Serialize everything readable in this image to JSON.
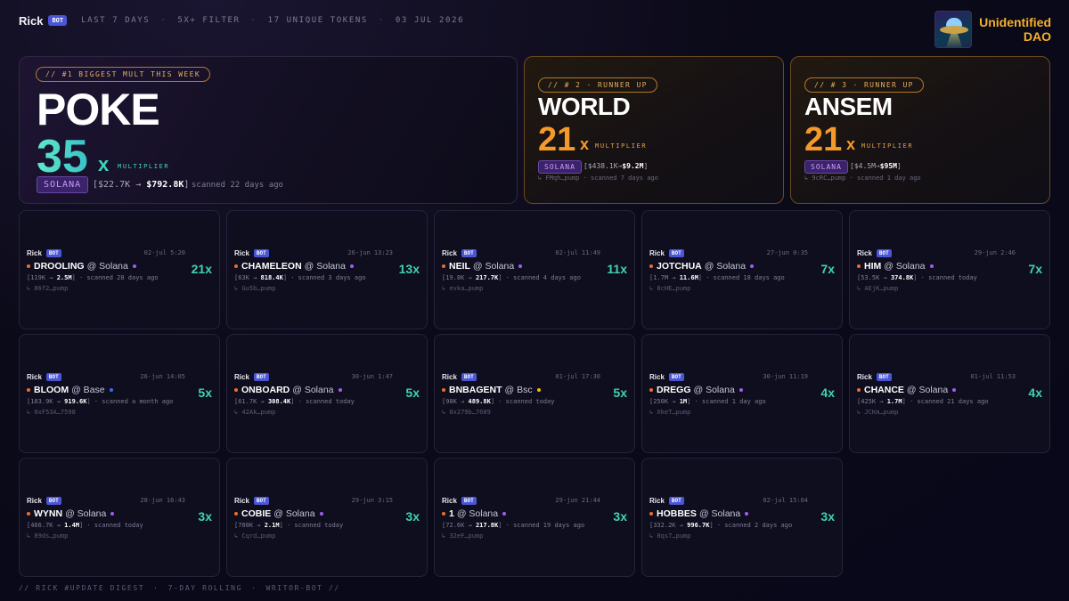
{
  "header": {
    "brand": "Rick",
    "bot_badge": "BOT",
    "meta": [
      "LAST 7 DAYS",
      "5X+ FILTER",
      "17 UNIQUE TOKENS",
      "03 JUL 2026"
    ],
    "separator": "·"
  },
  "dao": {
    "line1": "Unidentified",
    "line2": "DAO",
    "logo_icon": "ufo-icon"
  },
  "hero": [
    {
      "pill": "//  #1 BIGGEST MULT THIS WEEK",
      "token": "POKE",
      "mult": "35",
      "x": "x",
      "mult_label": "MULTIPLIER",
      "chain": "SOLANA",
      "range_pre": "[$22.7K → ",
      "range_to": "$792.8K",
      "range_post": "]",
      "scanned": "scanned 22 days ago"
    },
    {
      "pill": "// # 2 · RUNNER UP",
      "token": "WORLD",
      "mult": "21",
      "x": "x",
      "mult_label": "MULTIPLIER",
      "chain": "SOLANA",
      "range_pre": "[$438.1K→",
      "range_to": "$9.2M",
      "range_post": "]",
      "addr": "↳ FMqh…pump · scanned 7 days ago"
    },
    {
      "pill": "// # 3 · RUNNER UP",
      "token": "ANSEM",
      "mult": "21",
      "x": "x",
      "mult_label": "MULTIPLIER",
      "chain": "SOLANA",
      "range_pre": "[$4.5M→",
      "range_to": "$95M",
      "range_post": "]",
      "addr": "↳ 9cRC…pump · scanned 1 day ago"
    }
  ],
  "cards": [
    {
      "rick": "Rick",
      "bot": "BOT",
      "date": "02-jul 5:20",
      "token": "DROOLING",
      "at": "@ Solana",
      "chain_color": "#a45cf0",
      "mult": "21x",
      "range_pre": "[119K → ",
      "range_to": "2.5M",
      "range_post": "] · scanned 28 days ago",
      "addr": "↳ 86f2…pump"
    },
    {
      "rick": "Rick",
      "bot": "BOT",
      "date": "26-jun 13:23",
      "token": "CHAMELEON",
      "at": "@ Solana",
      "chain_color": "#a45cf0",
      "mult": "13x",
      "range_pre": "[63K → ",
      "range_to": "818.4K",
      "range_post": "] · scanned 3 days ago",
      "addr": "↳ Gu5b…pump"
    },
    {
      "rick": "Rick",
      "bot": "BOT",
      "date": "02-jul 11:49",
      "token": "NEIL",
      "at": "@ Solana",
      "chain_color": "#a45cf0",
      "mult": "11x",
      "range_pre": "[19.8K → ",
      "range_to": "217.7K",
      "range_post": "] · scanned 4 days ago",
      "addr": "↳ evka…pump"
    },
    {
      "rick": "Rick",
      "bot": "BOT",
      "date": "27-jun 0:35",
      "token": "JOTCHUA",
      "at": "@ Solana",
      "chain_color": "#a45cf0",
      "mult": "7x",
      "range_pre": "[1.7M → ",
      "range_to": "11.6M",
      "range_post": "] · scanned 18 days ago",
      "addr": "↳ 8cHE…pump"
    },
    {
      "rick": "Rick",
      "bot": "BOT",
      "date": "29-jun 2:46",
      "token": "HIM",
      "at": "@ Solana",
      "chain_color": "#a45cf0",
      "mult": "7x",
      "range_pre": "[53.5K → ",
      "range_to": "374.8K",
      "range_post": "] · scanned today",
      "addr": "↳ AEjK…pump"
    },
    {
      "rick": "Rick",
      "bot": "BOT",
      "date": "26-jun 14:05",
      "token": "BLOOM",
      "at": "@ Base",
      "chain_color": "#3a6cf0",
      "mult": "5x",
      "range_pre": "[183.9K → ",
      "range_to": "919.6K",
      "range_post": "] · scanned a month ago",
      "addr": "↳ 0xF53A…7598"
    },
    {
      "rick": "Rick",
      "bot": "BOT",
      "date": "30-jun 1:47",
      "token": "ONBOARD",
      "at": "@ Solana",
      "chain_color": "#a45cf0",
      "mult": "5x",
      "range_pre": "[61.7K → ",
      "range_to": "308.4K",
      "range_post": "] · scanned today",
      "addr": "↳ 42Ak…pump"
    },
    {
      "rick": "Rick",
      "bot": "BOT",
      "date": "01-jul 17:30",
      "token": "BNBAGENT",
      "at": "@ Bsc",
      "chain_color": "#f0b90b",
      "mult": "5x",
      "range_pre": "[98K → ",
      "range_to": "489.8K",
      "range_post": "] · scanned today",
      "addr": "↳ 0x279b…7689"
    },
    {
      "rick": "Rick",
      "bot": "BOT",
      "date": "30-jun 11:19",
      "token": "DREGG",
      "at": "@ Solana",
      "chain_color": "#a45cf0",
      "mult": "4x",
      "range_pre": "[250K → ",
      "range_to": "1M",
      "range_post": "] · scanned 1 day ago",
      "addr": "↳ XkeT…pump"
    },
    {
      "rick": "Rick",
      "bot": "BOT",
      "date": "01-jul 11:53",
      "token": "CHANCE",
      "at": "@ Solana",
      "chain_color": "#a45cf0",
      "mult": "4x",
      "range_pre": "[425K → ",
      "range_to": "1.7M",
      "range_post": "] · scanned 21 days ago",
      "addr": "↳ JCKm…pump"
    },
    {
      "rick": "Rick",
      "bot": "BOT",
      "date": "28-jun 16:43",
      "token": "WYNN",
      "at": "@ Solana",
      "chain_color": "#a45cf0",
      "mult": "3x",
      "range_pre": "[466.7K → ",
      "range_to": "1.4M",
      "range_post": "] · scanned today",
      "addr": "↳ 89ds…pump"
    },
    {
      "rick": "Rick",
      "bot": "BOT",
      "date": "29-jun 3:15",
      "token": "COBIE",
      "at": "@ Solana",
      "chain_color": "#a45cf0",
      "mult": "3x",
      "range_pre": "[700K → ",
      "range_to": "2.1M",
      "range_post": "] · scanned today",
      "addr": "↳ Cqrd…pump"
    },
    {
      "rick": "Rick",
      "bot": "BOT",
      "date": "29-jun 21:44",
      "token": "1",
      "at": "@ Solana",
      "chain_color": "#a45cf0",
      "mult": "3x",
      "range_pre": "[72.6K → ",
      "range_to": "217.8K",
      "range_post": "] · scanned 19 days ago",
      "addr": "↳ 32eF…pump"
    },
    {
      "rick": "Rick",
      "bot": "BOT",
      "date": "02-jul 15:04",
      "token": "HOBBES",
      "at": "@ Solana",
      "chain_color": "#a45cf0",
      "mult": "3x",
      "range_pre": "[332.2K → ",
      "range_to": "996.7K",
      "range_post": "] · scanned 2 days ago",
      "addr": "↳ 8qs7…pump"
    }
  ],
  "footer": {
    "parts": [
      "// RICK #UPDATE DIGEST",
      "7-DAY ROLLING",
      "WRITOR-BOT //"
    ],
    "separator": "·"
  }
}
